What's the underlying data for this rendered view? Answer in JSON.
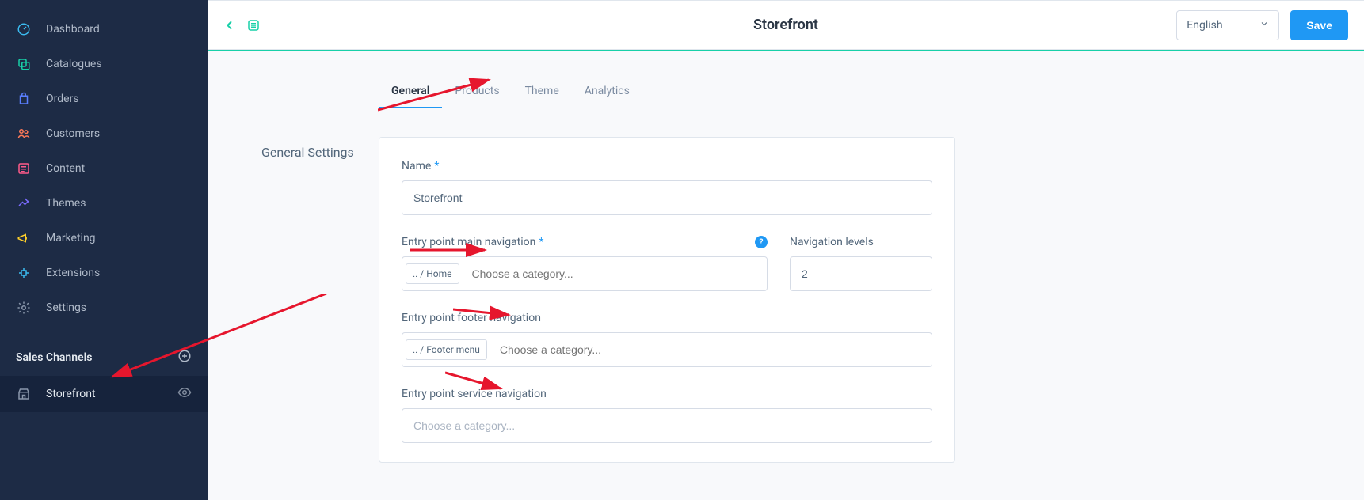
{
  "sidebar": {
    "items": [
      {
        "label": "Dashboard",
        "icon": "gauge"
      },
      {
        "label": "Catalogues",
        "icon": "copy"
      },
      {
        "label": "Orders",
        "icon": "bag"
      },
      {
        "label": "Customers",
        "icon": "users"
      },
      {
        "label": "Content",
        "icon": "content"
      },
      {
        "label": "Themes",
        "icon": "paint"
      },
      {
        "label": "Marketing",
        "icon": "megaphone"
      },
      {
        "label": "Extensions",
        "icon": "plugin"
      },
      {
        "label": "Settings",
        "icon": "gear"
      }
    ],
    "section_heading": "Sales Channels",
    "channels": [
      {
        "label": "Storefront",
        "icon": "store"
      }
    ]
  },
  "header": {
    "title": "Storefront",
    "language": "English",
    "save_label": "Save"
  },
  "tabs": [
    {
      "label": "General",
      "active": true
    },
    {
      "label": "Products",
      "active": false
    },
    {
      "label": "Theme",
      "active": false
    },
    {
      "label": "Analytics",
      "active": false
    }
  ],
  "general": {
    "section_title": "General Settings",
    "name_label": "Name",
    "name_value": "Storefront",
    "entry_main_label": "Entry point main navigation",
    "entry_main_token": ".. / Home",
    "entry_main_placeholder": "Choose a category...",
    "nav_levels_label": "Navigation levels",
    "nav_levels_value": "2",
    "entry_footer_label": "Entry point footer navigation",
    "entry_footer_token": ".. / Footer menu",
    "entry_footer_placeholder": "Choose a category...",
    "entry_service_label": "Entry point service navigation",
    "entry_service_placeholder": "Choose a category..."
  },
  "icon_colors": {
    "dashboard": "#3bbbf0",
    "catalogues": "#18d0a8",
    "orders": "#5a7fff",
    "customers": "#ff7a59",
    "content": "#ff5a8a",
    "themes": "#7a6bff",
    "marketing": "#ffd02a",
    "extensions": "#3bbbf0",
    "settings": "#8a97ab",
    "storefront": "#8a97ab"
  }
}
